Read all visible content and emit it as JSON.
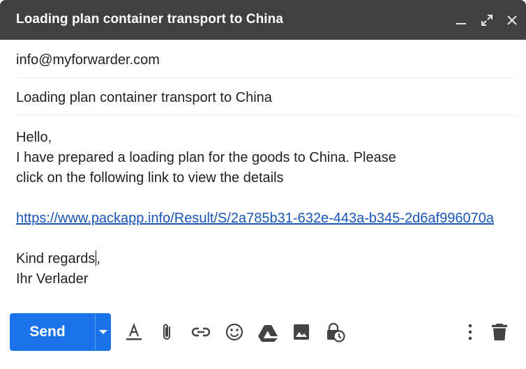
{
  "window": {
    "title": "Loading plan container transport to China",
    "controls": [
      "minimize-icon",
      "fullscreen-icon",
      "close-icon"
    ]
  },
  "compose": {
    "to": "info@myforwarder.com",
    "subject": "Loading plan container transport to China",
    "body": {
      "line1": "Hello,",
      "line2": "I have prepared a loading plan for the goods to China. Please",
      "line3": "click on the following link to view the details",
      "link": "https://www.packapp.info/Result/S/2a785b31-632e-443a-b345-2d6af996070a",
      "closing1": "Kind regards",
      "closing1_tail": ",",
      "closing2": "Ihr Verlader"
    }
  },
  "toolbar": {
    "send_label": "Send",
    "accent_color": "#1a73e8",
    "tools": [
      "formatting-icon",
      "attach-icon",
      "link-icon",
      "emoji-icon",
      "drive-icon",
      "image-icon",
      "confidential-icon",
      "more-options-icon",
      "discard-icon"
    ]
  }
}
